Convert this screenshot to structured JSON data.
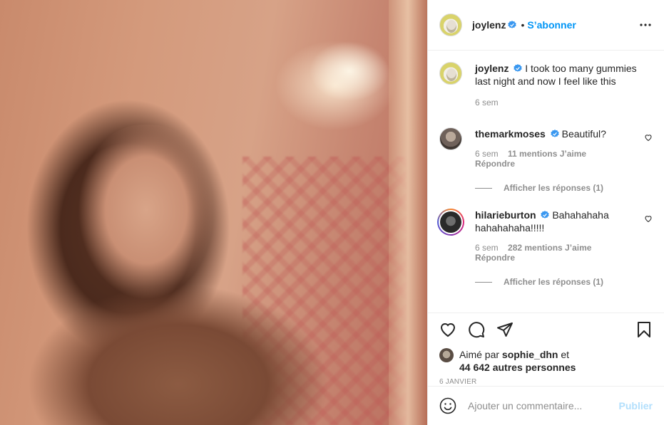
{
  "post": {
    "author": "joylenz",
    "follow_label": "S’abonner",
    "dot": "•",
    "caption": "I took too many gummies last night and now I feel like this",
    "caption_age": "6 sem",
    "likes": {
      "prefix": "Aimé par",
      "user": "sophie_dhn",
      "joiner": "et",
      "others": "44 642 autres personnes"
    },
    "date": "6 JANVIER"
  },
  "comments": [
    {
      "user": "themarkmoses",
      "verified": true,
      "text": "Beautiful?",
      "age": "6 sem",
      "likes": "11 mentions J’aime",
      "reply_label": "Répondre",
      "view_replies": "Afficher les réponses (1)"
    },
    {
      "user": "hilarieburton",
      "verified": true,
      "text": "Bahahahaha hahahahaha!!!!!",
      "age": "6 sem",
      "likes": "282 mentions J’aime",
      "reply_label": "Répondre",
      "view_replies": "Afficher les réponses (1)"
    }
  ],
  "composer": {
    "placeholder": "Ajouter un commentaire...",
    "publish_label": "Publier"
  },
  "colors": {
    "accent": "#0095f6",
    "publish_disabled": "#b2dffc",
    "secondary_text": "#8e8e8e",
    "divider": "#efefef"
  },
  "icons": [
    "more-icon",
    "verified-badge-icon",
    "heart-icon",
    "comment-icon",
    "share-icon",
    "bookmark-icon",
    "emoji-icon"
  ]
}
